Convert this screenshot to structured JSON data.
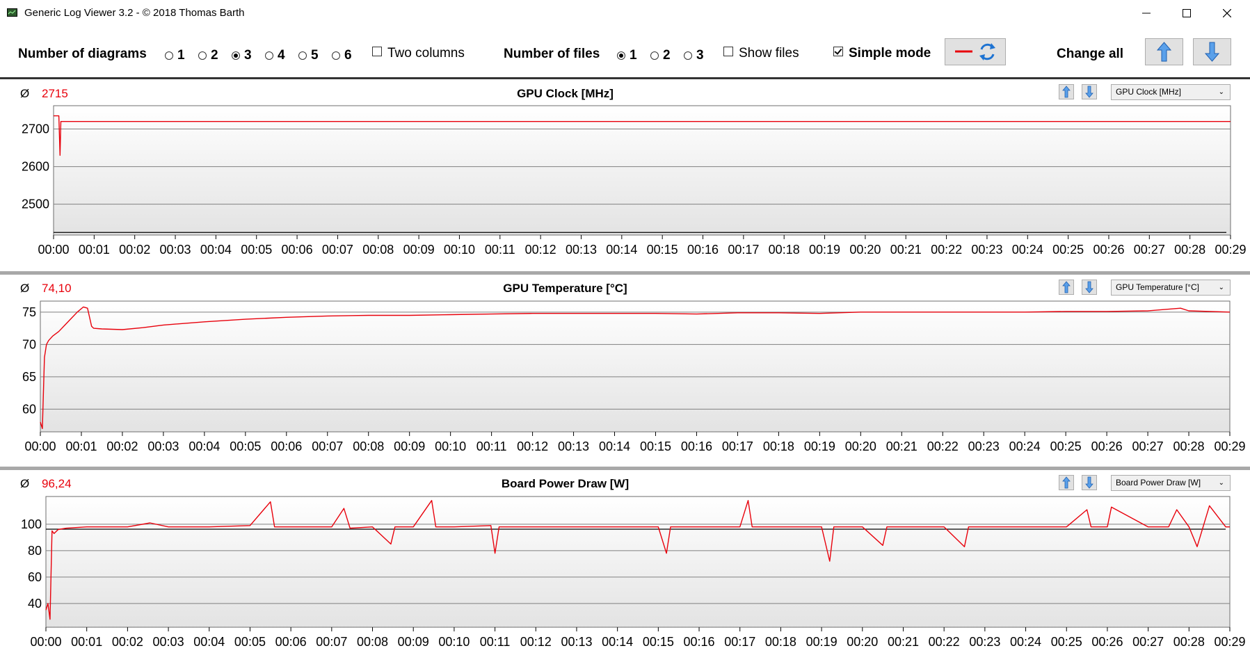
{
  "window": {
    "title": "Generic Log Viewer 3.2 - © 2018 Thomas Barth",
    "icons": [
      "app-icon",
      "minimize-icon",
      "maximize-icon",
      "close-icon"
    ]
  },
  "toolbar": {
    "num_diagrams_label": "Number of diagrams",
    "diagram_options": [
      "1",
      "2",
      "3",
      "4",
      "5",
      "6"
    ],
    "diagram_selected": "3",
    "two_columns_label": "Two columns",
    "two_columns_checked": false,
    "num_files_label": "Number of files",
    "file_options": [
      "1",
      "2",
      "3"
    ],
    "file_selected": "1",
    "show_files_label": "Show files",
    "show_files_checked": false,
    "simple_mode_label": "Simple mode",
    "simple_mode_checked": true,
    "change_all_label": "Change all"
  },
  "colors": {
    "series": "#e8000b",
    "avg_line": "#000000",
    "grid": "#808080",
    "plot_bg_top": "#ffffff",
    "plot_bg_bottom": "#e3e3e3"
  },
  "time_labels": [
    "00:00",
    "00:01",
    "00:02",
    "00:03",
    "00:04",
    "00:05",
    "00:06",
    "00:07",
    "00:08",
    "00:09",
    "00:10",
    "00:11",
    "00:12",
    "00:13",
    "00:14",
    "00:15",
    "00:16",
    "00:17",
    "00:18",
    "00:19",
    "00:20",
    "00:21",
    "00:22",
    "00:23",
    "00:24",
    "00:25",
    "00:26",
    "00:27",
    "00:28",
    "00:29"
  ],
  "panels": [
    {
      "avg_symbol": "Ø",
      "avg_value": "2715",
      "title": "GPU Clock [MHz]",
      "combo_value": "GPU Clock [MHz]",
      "y_ticks": [
        "2500",
        "2600",
        "2700"
      ]
    },
    {
      "avg_symbol": "Ø",
      "avg_value": "74,10",
      "title": "GPU Temperature [°C]",
      "combo_value": "GPU Temperature [°C]",
      "y_ticks": [
        "60",
        "65",
        "70",
        "75"
      ]
    },
    {
      "avg_symbol": "Ø",
      "avg_value": "96,24",
      "title": "Board Power Draw [W]",
      "combo_value": "Board Power Draw [W]",
      "y_ticks": [
        "40",
        "60",
        "80",
        "100"
      ]
    }
  ],
  "chart_data": [
    {
      "type": "line",
      "title": "GPU Clock [MHz]",
      "xlabel": "",
      "ylabel": "",
      "ylim": [
        2418,
        2762
      ],
      "xlim": [
        0,
        29
      ],
      "x_unit": "minutes",
      "average_line": 2425,
      "series": [
        {
          "x": [
            0,
            0.13,
            0.16,
            0.18,
            0.22,
            1,
            5,
            10,
            15,
            20,
            25,
            29
          ],
          "values": [
            2735,
            2735,
            2630,
            2720,
            2720,
            2720,
            2720,
            2720,
            2720,
            2720,
            2720,
            2720
          ]
        }
      ]
    },
    {
      "type": "line",
      "title": "GPU Temperature [°C]",
      "xlabel": "",
      "ylabel": "",
      "ylim": [
        56.5,
        76.7
      ],
      "xlim": [
        0,
        29
      ],
      "x_unit": "minutes",
      "series": [
        {
          "x": [
            0,
            0.05,
            0.1,
            0.15,
            0.2,
            0.3,
            0.45,
            0.6,
            0.75,
            0.9,
            1.05,
            1.15,
            1.25,
            1.3,
            1.5,
            2,
            2.5,
            3,
            4,
            5,
            6,
            7,
            8,
            9,
            10,
            11,
            12,
            13,
            14,
            15,
            16,
            17,
            18,
            19,
            20,
            21,
            22,
            23,
            24,
            25,
            26,
            27,
            27.8,
            28,
            29
          ],
          "values": [
            58.0,
            57.0,
            68.0,
            70.0,
            70.6,
            71.3,
            72.0,
            73.0,
            74.0,
            75.0,
            75.8,
            75.6,
            72.8,
            72.5,
            72.4,
            72.3,
            72.6,
            73.0,
            73.5,
            73.9,
            74.2,
            74.4,
            74.5,
            74.5,
            74.6,
            74.7,
            74.8,
            74.8,
            74.8,
            74.8,
            74.7,
            74.9,
            74.9,
            74.8,
            75.0,
            75.0,
            75.0,
            75.0,
            75.0,
            75.1,
            75.1,
            75.2,
            75.6,
            75.2,
            75.0
          ]
        }
      ]
    },
    {
      "type": "line",
      "title": "Board Power Draw [W]",
      "xlabel": "",
      "ylabel": "",
      "ylim": [
        22,
        121
      ],
      "xlim": [
        0,
        29
      ],
      "x_unit": "minutes",
      "average_line": 96.24,
      "series": [
        {
          "x": [
            0,
            0.05,
            0.1,
            0.15,
            0.2,
            0.3,
            0.5,
            1,
            2,
            2.55,
            3,
            4,
            5,
            5.5,
            5.6,
            6,
            7,
            7.3,
            7.45,
            8,
            8.45,
            8.55,
            9,
            9.45,
            9.55,
            9.65,
            10,
            10.9,
            11,
            11.1,
            12,
            13,
            13.95,
            14,
            14.5,
            15,
            15.2,
            15.3,
            16,
            17,
            17.2,
            17.3,
            18,
            19,
            19.2,
            19.3,
            20,
            20.5,
            20.6,
            21,
            22,
            22.5,
            22.6,
            23,
            24,
            25,
            25.5,
            25.6,
            26,
            26.1,
            27,
            27.5,
            27.7,
            28,
            28.2,
            28.5,
            28.9,
            29
          ],
          "values": [
            35,
            40,
            28,
            95,
            93,
            96,
            97,
            98,
            98,
            101,
            98,
            98,
            99,
            117,
            98,
            98,
            98,
            112,
            97,
            98,
            85,
            98,
            98,
            118,
            98,
            98,
            98,
            99,
            78,
            98,
            98,
            98,
            98,
            98,
            98,
            98,
            78,
            98,
            98,
            98,
            118,
            98,
            98,
            98,
            72,
            98,
            98,
            84,
            98,
            98,
            98,
            83,
            98,
            98,
            98,
            98,
            111,
            98,
            98,
            113,
            98,
            98,
            111,
            98,
            83,
            114,
            98,
            98
          ]
        }
      ]
    }
  ]
}
